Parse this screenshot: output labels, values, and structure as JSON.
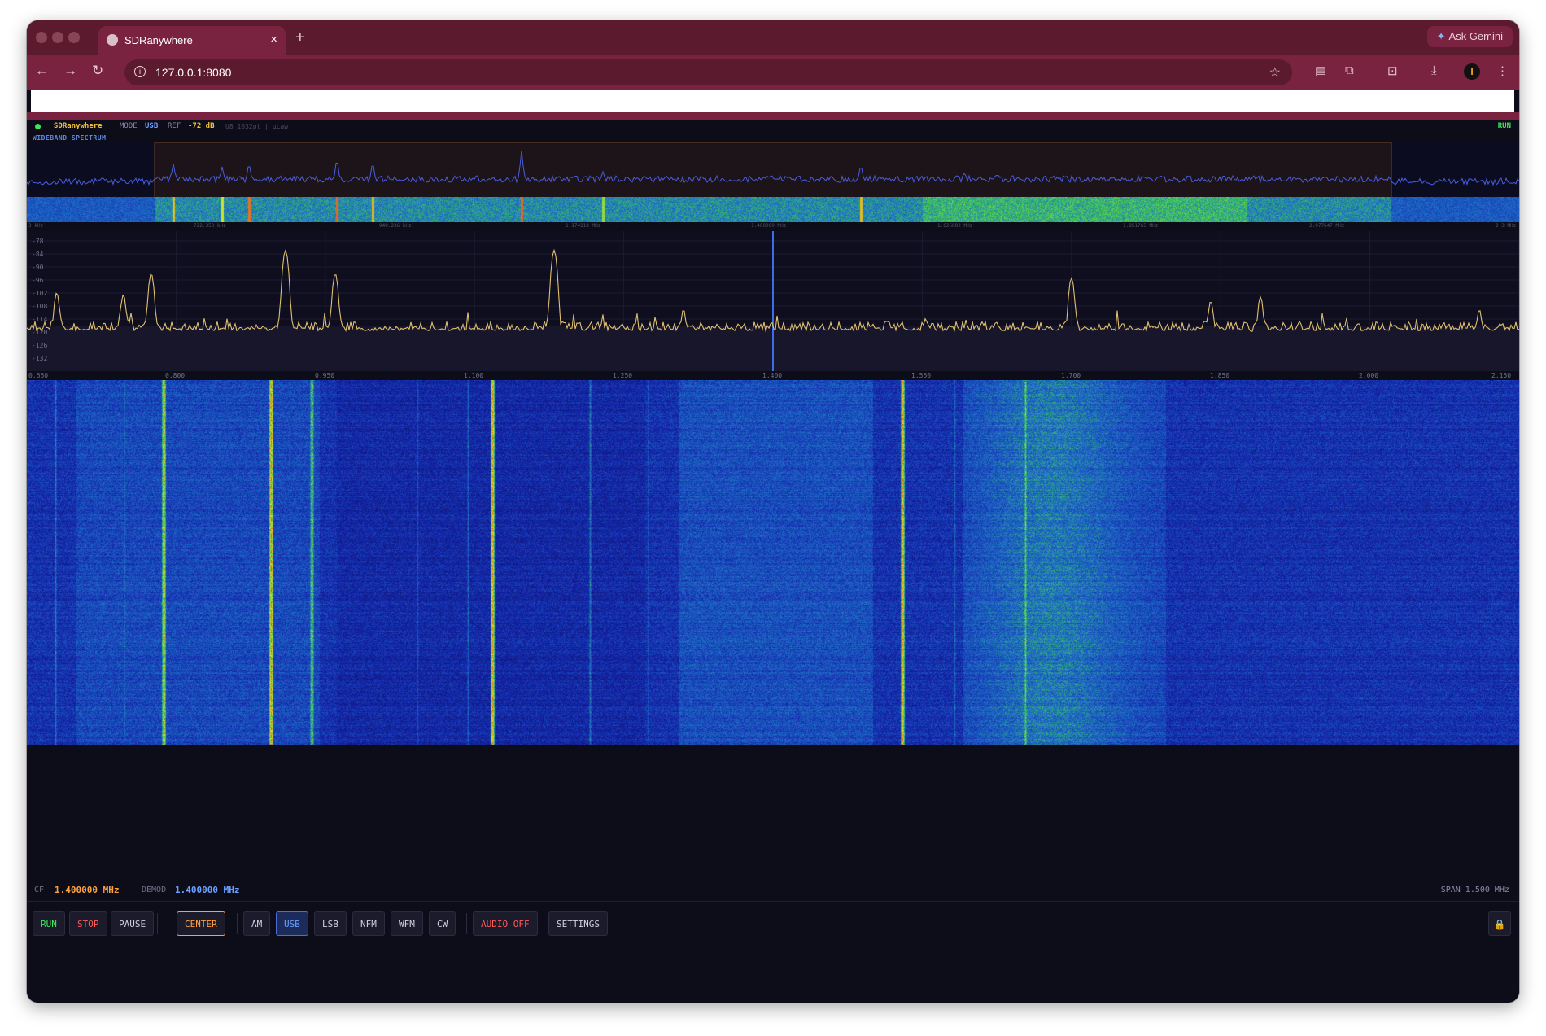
{
  "browser": {
    "tab_title": "SDRanywhere",
    "tab_close": "×",
    "new_tab": "+",
    "ask_gemini": "Ask Gemini",
    "url": "127.0.0.1:8080",
    "avatar_letter": "I"
  },
  "app": {
    "name": "SDRanywhere",
    "mode_label": "MODE",
    "mode_value": "USB",
    "ref_label": "REF",
    "ref_value": "-72 dB",
    "fft_info": "U8 1032pt | µLaw",
    "run_status": "RUN",
    "wideband_label": "WIDEBAND SPECTRUM",
    "wideband_ticks": [
      "3 kHz",
      "722.353 kHz",
      "948.236 kHz",
      "1.174118 MHz",
      "1.400000 MHz",
      "1.625882 MHz",
      "1.851765 MHz",
      "2.077647 MHz",
      "2.3 MHz"
    ],
    "db_labels": [
      "-78",
      "-84",
      "-90",
      "-96",
      "-102",
      "-108",
      "-114",
      "-120",
      "-126",
      "-132"
    ],
    "freq_ticks": [
      "0.650",
      "0.800",
      "0.950",
      "1.100",
      "1.250",
      "1.400",
      "1.550",
      "1.700",
      "1.850",
      "2.000",
      "2.150"
    ]
  },
  "readout": {
    "cf_label": "CF",
    "cf_value": "1.400000 MHz",
    "demod_label": "DEMOD",
    "demod_value": "1.400000 MHz",
    "span_text": "SPAN 1.500 MHz"
  },
  "controls": {
    "run": "RUN",
    "stop": "STOP",
    "pause": "PAUSE",
    "center": "CENTER",
    "am": "AM",
    "usb": "USB",
    "lsb": "LSB",
    "nfm": "NFM",
    "wfm": "WFM",
    "cw": "CW",
    "audio": "AUDIO OFF",
    "settings": "SETTINGS"
  },
  "colors": {
    "browser_frame": "#7a2340",
    "spectrum_trace": "#e0c070",
    "wideband_trace": "#4a5ee0",
    "run_green": "#3fe65a",
    "stop_red": "#ff5a5a",
    "center_orange": "#ffa040",
    "usb_blue": "#6aa0ff",
    "app_bg": "#0d0d1a"
  },
  "spectrum": {
    "tuned_frequency_mhz": 1.4,
    "span_mhz": 1.5,
    "db_range": [
      -132,
      -72
    ],
    "peaks": [
      {
        "mhz": 0.68,
        "db": -98
      },
      {
        "mhz": 0.747,
        "db": -99
      },
      {
        "mhz": 0.775,
        "db": -89
      },
      {
        "mhz": 0.91,
        "db": -78
      },
      {
        "mhz": 0.96,
        "db": -89
      },
      {
        "mhz": 1.18,
        "db": -78
      },
      {
        "mhz": 1.31,
        "db": -106
      },
      {
        "mhz": 1.7,
        "db": -91
      },
      {
        "mhz": 1.84,
        "db": -102
      },
      {
        "mhz": 1.89,
        "db": -100
      },
      {
        "mhz": 2.11,
        "db": -106
      }
    ]
  }
}
